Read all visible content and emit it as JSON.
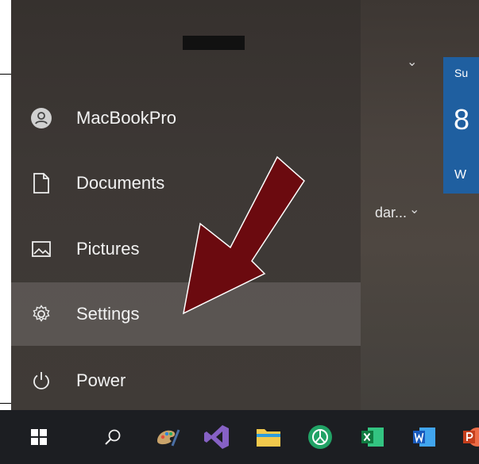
{
  "start_menu": {
    "items": [
      {
        "label": "MacBookPro",
        "icon": "user-icon"
      },
      {
        "label": "Documents",
        "icon": "document-icon"
      },
      {
        "label": "Pictures",
        "icon": "pictures-icon"
      },
      {
        "label": "Settings",
        "icon": "gear-icon",
        "selected": true
      },
      {
        "label": "Power",
        "icon": "power-icon"
      }
    ]
  },
  "tiles": {
    "weather_tile": {
      "line1": "Su",
      "line2": "8",
      "line3": "W"
    },
    "calendar_group_label": "dar..."
  },
  "taskbar": {
    "icons": [
      "windows-start-icon",
      "search-icon",
      "paint-icon",
      "visual-studio-icon",
      "file-explorer-icon",
      "app-green-icon",
      "excel-icon",
      "word-icon",
      "powerpoint-icon"
    ]
  },
  "colors": {
    "annotation_arrow": "#6b0a0f",
    "tile_blue": "#1f5fa0",
    "taskbar": "#1c1e22"
  }
}
